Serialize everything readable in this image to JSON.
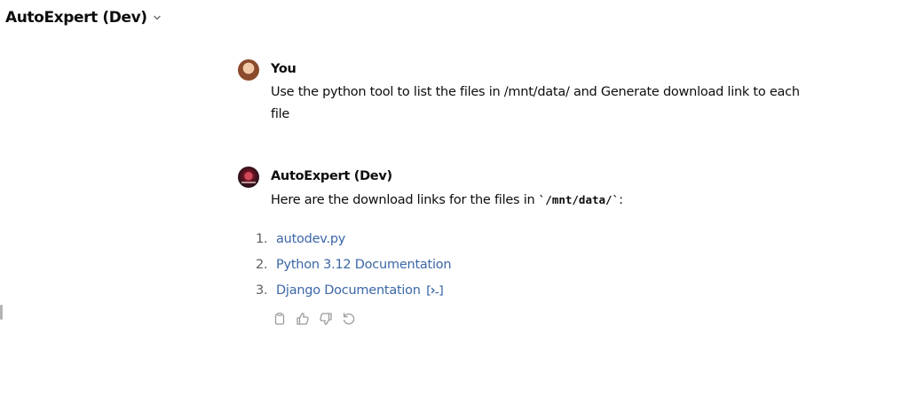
{
  "header": {
    "title": "AutoExpert (Dev)",
    "chevron_icon": "chevron-down-icon"
  },
  "messages": [
    {
      "role": "user",
      "author": "You",
      "avatar": "user-photo-avatar",
      "text": "Use the python tool to list the files in /mnt/data/ and Generate download link to each file"
    },
    {
      "role": "assistant",
      "author": "AutoExpert (Dev)",
      "avatar": "gpt-logo-avatar",
      "intro_prefix": "Here are the download links for the files in ",
      "intro_code": "`/mnt/data/`",
      "intro_suffix": ":",
      "links": [
        {
          "number": "1.",
          "label": "autodev.py"
        },
        {
          "number": "2.",
          "label": "Python 3.12 Documentation"
        },
        {
          "number": "3.",
          "label": "Django Documentation"
        }
      ],
      "code_indicator_icon": "code-run-icon",
      "actions": [
        "copy-icon",
        "thumbs-up-icon",
        "thumbs-down-icon",
        "regenerate-icon"
      ]
    }
  ],
  "colors": {
    "link": "#3b67a8",
    "text": "#0d0d0d",
    "muted": "#5d5d5d",
    "icon": "#9b9b9b"
  }
}
